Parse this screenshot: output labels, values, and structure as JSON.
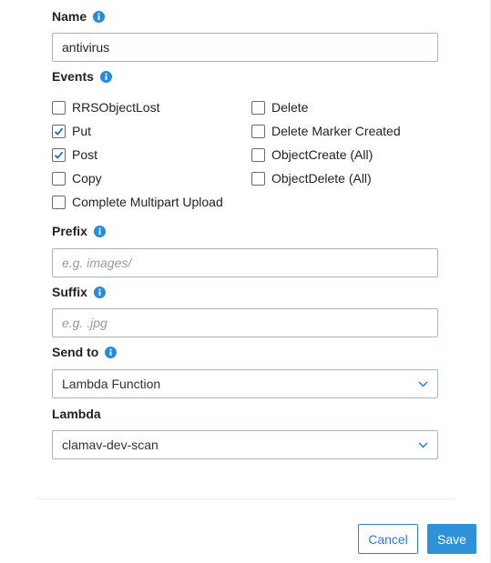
{
  "colors": {
    "accent": "#2f92d6",
    "info_icon": "#2a8ad4",
    "check": "#2a6fb0"
  },
  "name": {
    "label": "Name",
    "value": "antivirus",
    "icon": "info-icon"
  },
  "events": {
    "label": "Events",
    "icon": "info-icon",
    "options": [
      {
        "label": "RRSObjectLost",
        "checked": false
      },
      {
        "label": "Put",
        "checked": true
      },
      {
        "label": "Post",
        "checked": true
      },
      {
        "label": "Copy",
        "checked": false
      },
      {
        "label": "Complete Multipart Upload",
        "checked": false
      },
      {
        "label": "Delete",
        "checked": false
      },
      {
        "label": "Delete Marker Created",
        "checked": false
      },
      {
        "label": "ObjectCreate (All)",
        "checked": false
      },
      {
        "label": "ObjectDelete (All)",
        "checked": false
      }
    ]
  },
  "prefix": {
    "label": "Prefix",
    "value": "",
    "placeholder": "e.g. images/",
    "icon": "info-icon"
  },
  "suffix": {
    "label": "Suffix",
    "value": "",
    "placeholder": "e.g. .jpg",
    "icon": "info-icon"
  },
  "send_to": {
    "label": "Send to",
    "selected": "Lambda Function",
    "icon": "info-icon"
  },
  "lambda": {
    "label": "Lambda",
    "selected": "clamav-dev-scan"
  },
  "footer": {
    "cancel_label": "Cancel",
    "save_label": "Save"
  }
}
